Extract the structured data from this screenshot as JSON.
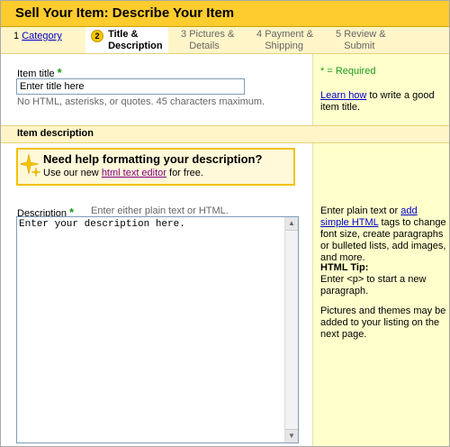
{
  "header": {
    "title": "Sell Your Item: Describe Your Item"
  },
  "steps": [
    {
      "num": "1",
      "label": "Category"
    },
    {
      "num": "2",
      "label_line1": "Title &",
      "label_line2": "Description"
    },
    {
      "num": "3",
      "label_line1": "Pictures &",
      "label_line2": "Details"
    },
    {
      "num": "4",
      "label_line1": "Payment &",
      "label_line2": "Shipping"
    },
    {
      "num": "5",
      "label_line1": "Review &",
      "label_line2": "Submit"
    }
  ],
  "item_title": {
    "label": "Item title",
    "required_star": "*",
    "value": "Enter title here",
    "hint": "No HTML, asterisks, or quotes. 45 characters maximum."
  },
  "sidebar": {
    "required_note": "* = Required",
    "learn_link": "Learn how",
    "learn_rest": " to write a good item title.",
    "desc_prefix": "Enter plain text or ",
    "desc_link": "add simple HTML",
    "desc_rest": " tags to change font size, create paragraphs or bulleted lists, add images, and more.",
    "tip_title": "HTML Tip:",
    "tip_body": "Enter <p> to start a new paragraph.",
    "pictures_note": "Pictures and themes may be added to your listing on the next page."
  },
  "item_description": {
    "section_title": "Item description",
    "help_title": "Need help formatting your description?",
    "help_prefix": "Use our new ",
    "help_link": "html text editor",
    "help_suffix": " for free.",
    "label": "Description",
    "required_star": "*",
    "hint": "Enter either plain text or HTML.",
    "value": "Enter your description here."
  },
  "colors": {
    "header_bg": "#ffcc2e",
    "band_bg": "#fff5c8",
    "sidebar_bg": "#ffffcc",
    "required_green": "#1a9b1a",
    "link_blue": "#0000cc"
  }
}
